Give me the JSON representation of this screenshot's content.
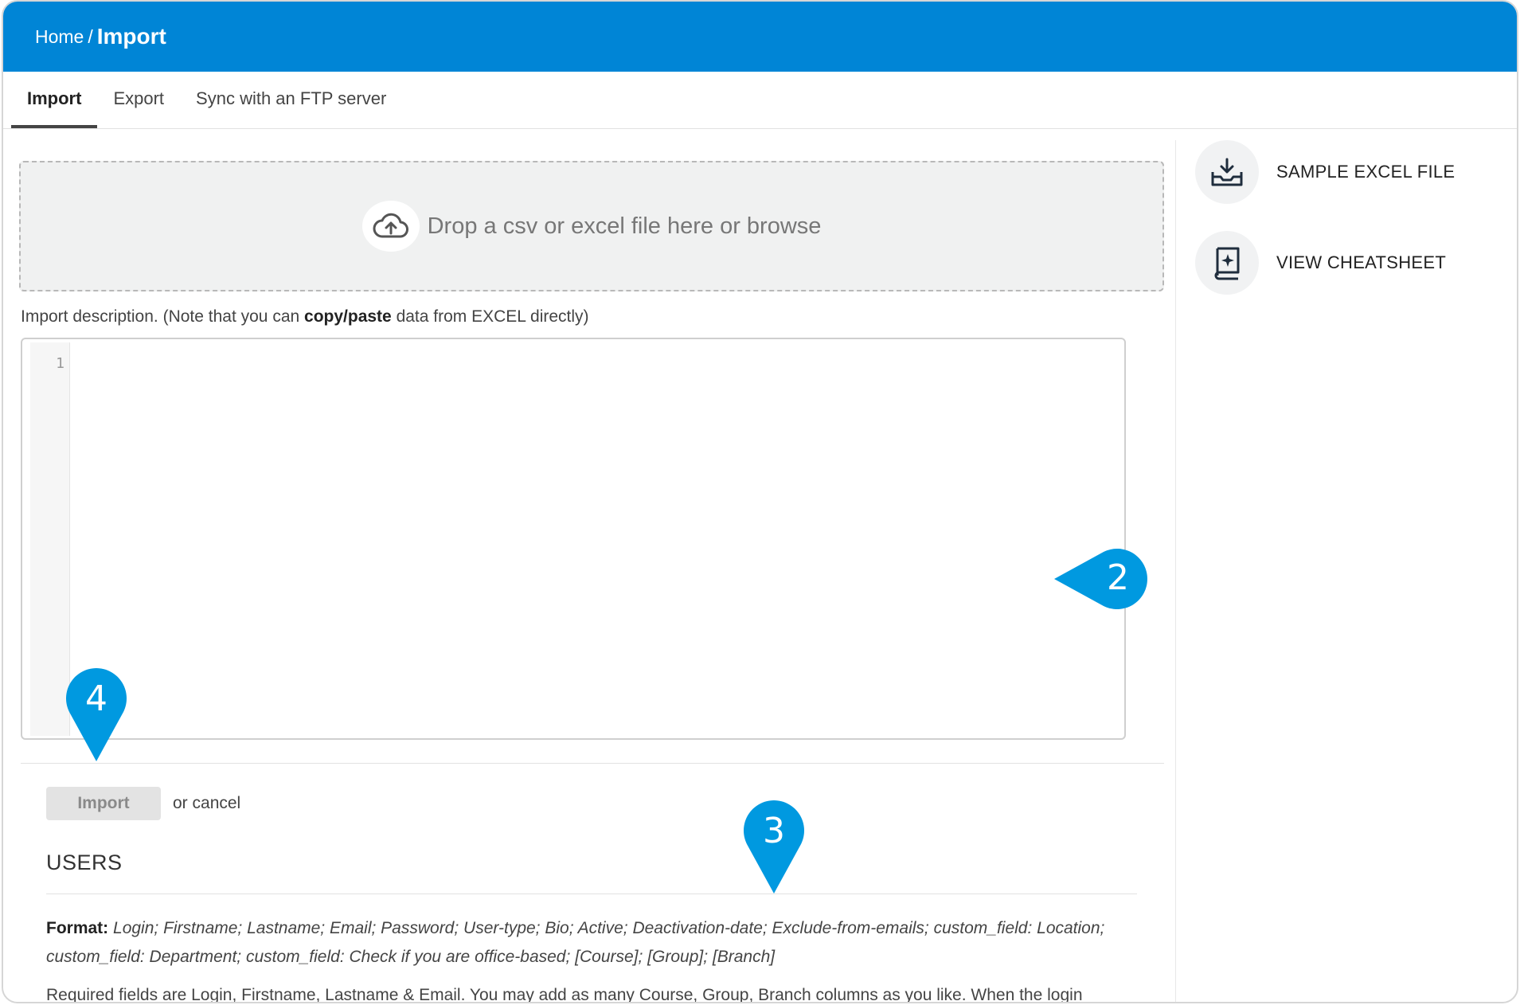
{
  "breadcrumb": {
    "home": "Home",
    "separator": "/",
    "current": "Import"
  },
  "tabs": [
    {
      "label": "Import",
      "active": true
    },
    {
      "label": "Export",
      "active": false
    },
    {
      "label": "Sync with an FTP server",
      "active": false
    }
  ],
  "dropzone": {
    "icon": "cloud-upload-icon",
    "text": "Drop a csv or excel file here or browse"
  },
  "description": {
    "prefix": "Import description. (Note that you can ",
    "bold": "copy/paste",
    "suffix": " data from EXCEL directly)"
  },
  "editor": {
    "line_number": "1",
    "value": ""
  },
  "actions": {
    "import_label": "Import",
    "cancel_prefix": "or ",
    "cancel_link": "cancel"
  },
  "users_section": {
    "title": "USERS",
    "format_label": "Format:",
    "format_value": "Login; Firstname; Lastname; Email; Password; User-type; Bio; Active; Deactivation-date; Exclude-from-emails; custom_field: Location; custom_field: Department; custom_field: Check if you are office-based; [Course]; [Group]; [Branch]",
    "required_text": "Required fields are Login, Firstname, Lastname & Email. You may add as many Course, Group, Branch columns as you like. When the login"
  },
  "sidebar": {
    "items": [
      {
        "label": "SAMPLE EXCEL FILE",
        "icon": "download-tray-icon"
      },
      {
        "label": "VIEW CHEATSHEET",
        "icon": "book-sparkle-icon"
      }
    ]
  },
  "markers": [
    {
      "number": "2",
      "color": "#0099e0"
    },
    {
      "number": "4",
      "color": "#0099e0"
    },
    {
      "number": "3",
      "color": "#0099e0"
    }
  ],
  "colors": {
    "header": "#0085d6",
    "marker": "#0099e0",
    "dropzone_bg": "#f0f1f1"
  }
}
